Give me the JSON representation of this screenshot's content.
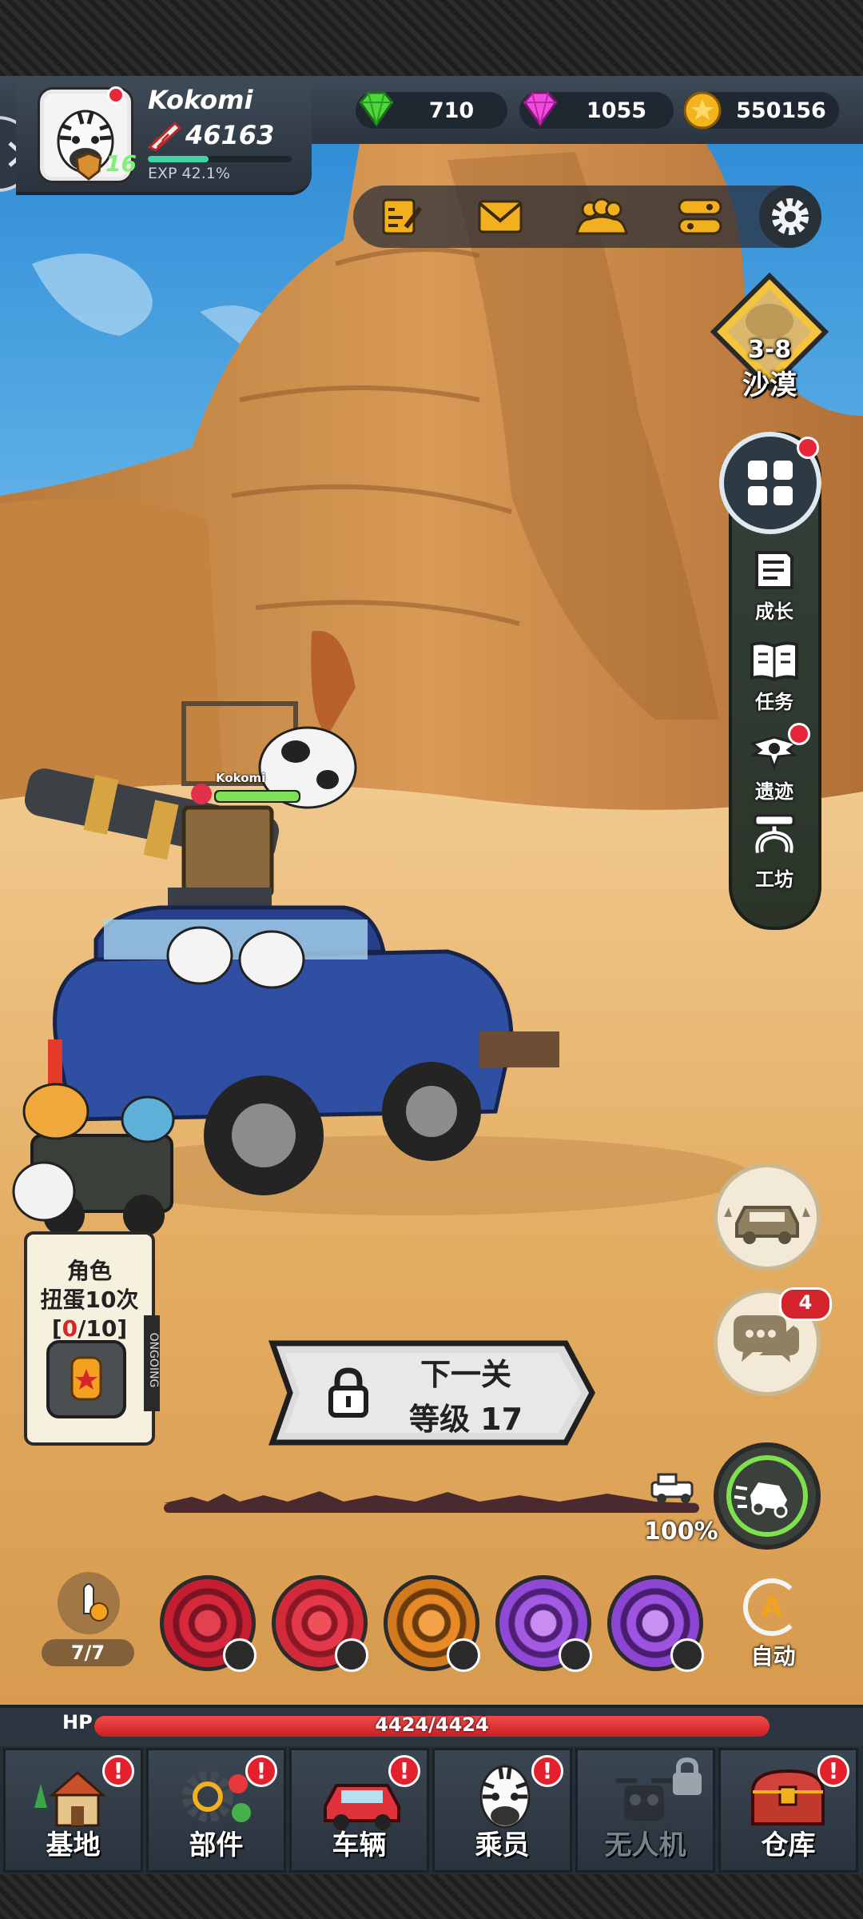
{
  "player": {
    "name": "Kokomi",
    "power": "46163",
    "level": "16",
    "exp_label": "EXP 42.1%",
    "exp_fraction": 0.421
  },
  "currencies": {
    "emerald": "710",
    "gem": "1055",
    "gold": "550156"
  },
  "stage": {
    "code": "3-8",
    "name": "沙漠"
  },
  "side_menu": {
    "growth": "成长",
    "tasks": "任务",
    "relics": "遗迹",
    "workshop": "工坊"
  },
  "chat_badge": "4",
  "character_nameplate": "Kokomi",
  "gacha": {
    "line1": "角色",
    "line2": "扭蛋10次",
    "open": "[",
    "count": "0",
    "sep": "/10]",
    "ongoing": "ONGOING"
  },
  "next_level": {
    "line1": "下一关",
    "line2": "等级 17"
  },
  "progress": {
    "percent_label": "100%",
    "fraction": 1.0
  },
  "ammo": "7/7",
  "auto_label": "自动",
  "hp": {
    "label": "HP",
    "value": "4424/4424",
    "fraction": 1.0
  },
  "nav": {
    "base": "基地",
    "parts": "部件",
    "vehicle": "车辆",
    "crew": "乘员",
    "drone": "无人机",
    "warehouse": "仓库"
  },
  "colors": {
    "sky": "#3aa6e6",
    "sand": "#e7b36a",
    "car_blue": "#2f4fa2",
    "accent_green": "#3fd3a5",
    "hp_red": "#e02a2c"
  }
}
